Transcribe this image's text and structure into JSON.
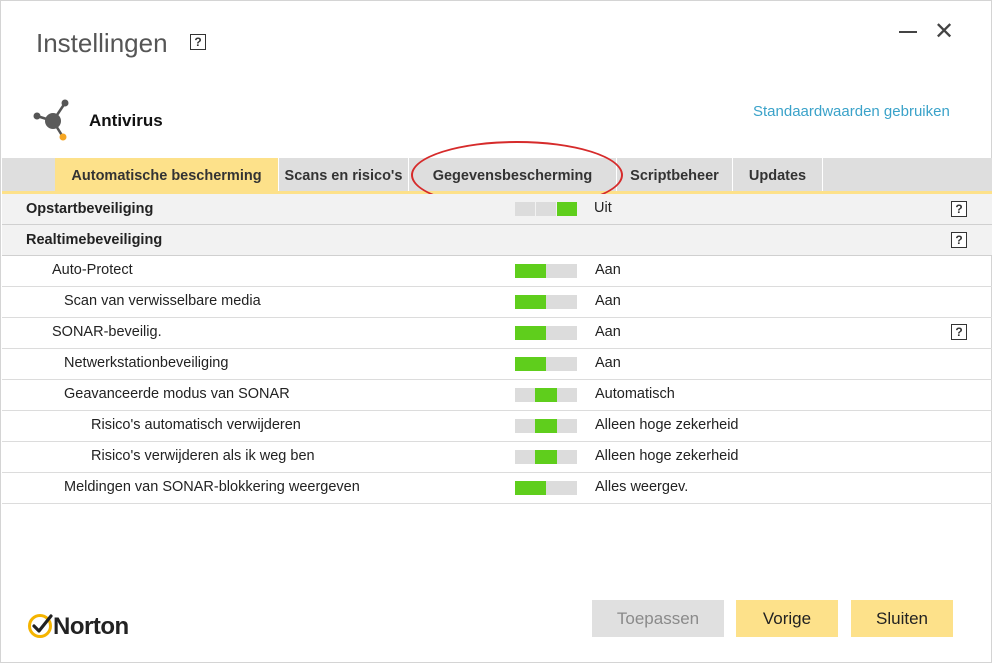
{
  "window": {
    "title": "Instellingen",
    "help_glyph": "?",
    "minimize_icon": "minimize-icon",
    "close_glyph": "✕"
  },
  "product": {
    "name": "Antivirus",
    "icon": "antivirus-icon",
    "defaults_link": "Standaardwaarden gebruiken"
  },
  "tabs": [
    {
      "label": "Automatische bescherming",
      "active": true
    },
    {
      "label": "Scans en risico's",
      "active": false
    },
    {
      "label": "Gegevensbescherming",
      "active": false
    },
    {
      "label": "Scriptbeheer",
      "active": false
    },
    {
      "label": "Updates",
      "active": false
    }
  ],
  "sections": [
    {
      "label": "Opstartbeveiliging",
      "toggle": "right",
      "value": "Uit",
      "help": "?"
    },
    {
      "label": "Realtimebeveiliging",
      "help": "?"
    }
  ],
  "rows": [
    {
      "label": "Auto-Protect",
      "toggle": "left",
      "value": "Aan"
    },
    {
      "label": "Scan van verwisselbare media",
      "toggle": "left",
      "value": "Aan"
    },
    {
      "label": "SONAR-beveilig.",
      "toggle": "left",
      "value": "Aan",
      "help": "?"
    },
    {
      "label": "Netwerkstationbeveiliging",
      "toggle": "left",
      "value": "Aan"
    },
    {
      "label": "Geavanceerde modus van SONAR",
      "toggle": "middle",
      "value": "Automatisch"
    },
    {
      "label": "Risico's automatisch verwijderen",
      "toggle": "middle",
      "value": "Alleen hoge zekerheid"
    },
    {
      "label": "Risico's verwijderen als ik weg ben",
      "toggle": "middle",
      "value": "Alleen hoge zekerheid"
    },
    {
      "label": "Meldingen van SONAR-blokkering weergeven",
      "toggle": "left",
      "value": "Alles weergev."
    }
  ],
  "footer": {
    "logo_text": "Norton",
    "apply": "Toepassen",
    "back": "Vorige",
    "close": "Sluiten"
  },
  "colors": {
    "accent_yellow": "#fde18a",
    "toggle_green": "#5fce1c",
    "link_blue": "#3aa2c9",
    "annotation_red": "#d62b2b"
  }
}
